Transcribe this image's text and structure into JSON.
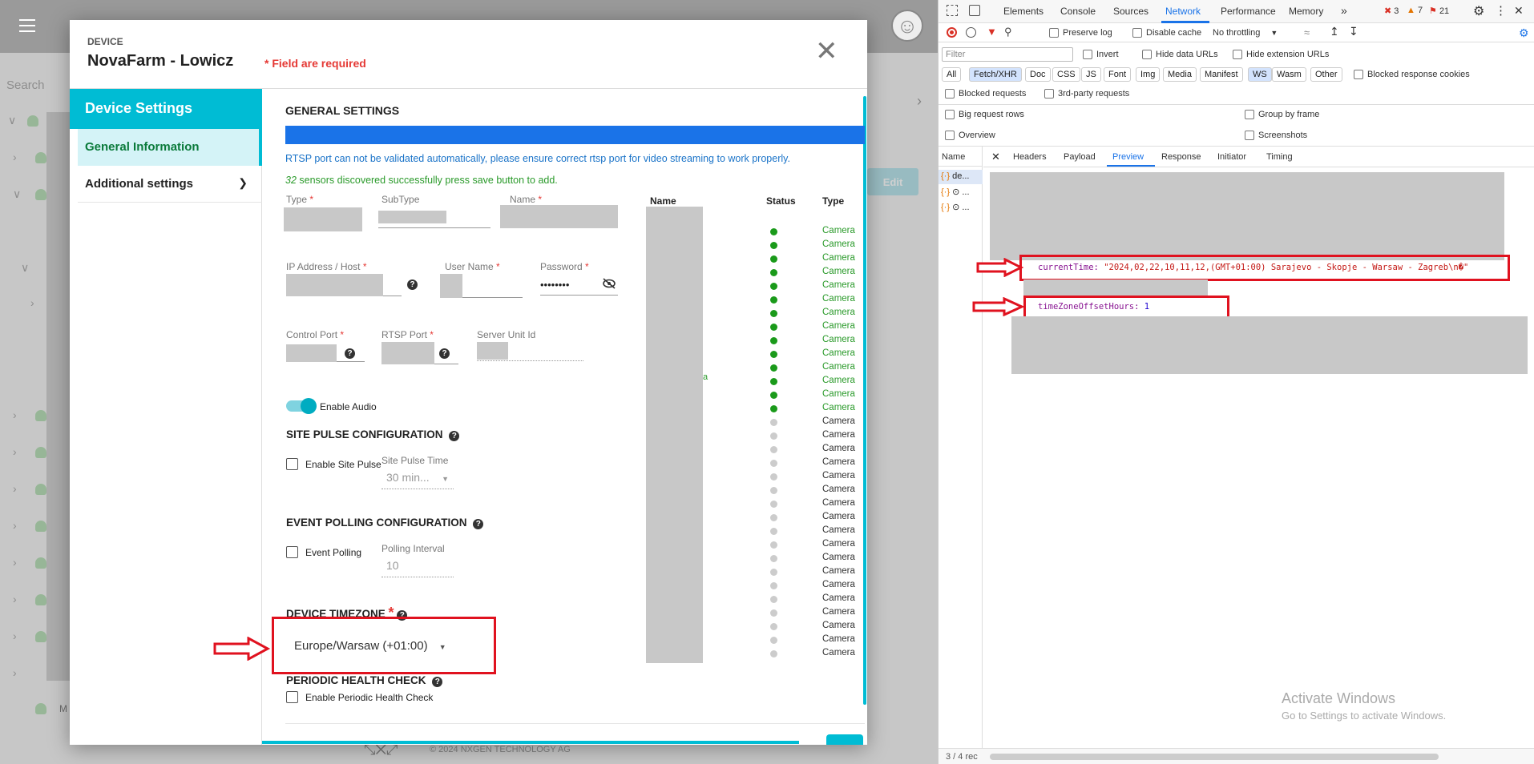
{
  "background_app": {
    "search_placeholder": "Search",
    "edit_button": "Edit",
    "footer_text": "© 2024 NXGEN TECHNOLOGY AG",
    "tree_partial_label": "M",
    "windows_watermark_title": "Activate Windows",
    "windows_watermark_sub": "Go to Settings to activate Windows."
  },
  "modal": {
    "kicker": "DEVICE",
    "title": "NovaFarm - Lowicz",
    "required_note": "* Field are required",
    "sidebar": {
      "header": "Device Settings",
      "items": [
        {
          "label": "General Information"
        },
        {
          "label": "Additional settings"
        }
      ]
    },
    "general": {
      "heading": "GENERAL SETTINGS",
      "rtsp_warning": "RTSP port can not be validated automatically, please ensure correct rtsp port for video streaming to work properly.",
      "sensors_count": "32",
      "sensors_msg": "sensors discovered successfully press save button to add.",
      "fields": {
        "type": "Type",
        "subtype": "SubType",
        "name": "Name",
        "ip": "IP Address / Host",
        "username": "User Name",
        "password": "Password",
        "password_value": "••••••••",
        "control_port": "Control Port",
        "rtsp_port": "RTSP Port",
        "server_unit_id": "Server Unit Id"
      },
      "enable_audio": "Enable Audio",
      "site_pulse_heading": "SITE PULSE CONFIGURATION",
      "enable_site_pulse": "Enable Site Pulse",
      "site_pulse_time_label": "Site Pulse Time",
      "site_pulse_time_value": "30 min...",
      "event_polling_heading": "EVENT POLLING CONFIGURATION",
      "event_polling": "Event Polling",
      "polling_interval_label": "Polling Interval",
      "polling_interval_value": "10",
      "timezone_heading": "DEVICE TIMEZONE",
      "timezone_value": "Europe/Warsaw (+01:00)",
      "health_heading": "PERIODIC HEALTH CHECK",
      "enable_health": "Enable Periodic Health Check"
    },
    "sensor_table": {
      "col_name": "Name",
      "col_status": "Status",
      "col_type": "Type",
      "stray_text": "a",
      "rows": [
        {
          "status": "online",
          "type": "Camera"
        },
        {
          "status": "online",
          "type": "Camera"
        },
        {
          "status": "online",
          "type": "Camera"
        },
        {
          "status": "online",
          "type": "Camera"
        },
        {
          "status": "online",
          "type": "Camera"
        },
        {
          "status": "online",
          "type": "Camera"
        },
        {
          "status": "online",
          "type": "Camera"
        },
        {
          "status": "online",
          "type": "Camera"
        },
        {
          "status": "online",
          "type": "Camera"
        },
        {
          "status": "online",
          "type": "Camera"
        },
        {
          "status": "online",
          "type": "Camera"
        },
        {
          "status": "online",
          "type": "Camera"
        },
        {
          "status": "online",
          "type": "Camera"
        },
        {
          "status": "online",
          "type": "Camera"
        },
        {
          "status": "offline",
          "type": "Camera"
        },
        {
          "status": "offline",
          "type": "Camera"
        },
        {
          "status": "offline",
          "type": "Camera"
        },
        {
          "status": "offline",
          "type": "Camera"
        },
        {
          "status": "offline",
          "type": "Camera"
        },
        {
          "status": "offline",
          "type": "Camera"
        },
        {
          "status": "offline",
          "type": "Camera"
        },
        {
          "status": "offline",
          "type": "Camera"
        },
        {
          "status": "offline",
          "type": "Camera"
        },
        {
          "status": "offline",
          "type": "Camera"
        },
        {
          "status": "offline",
          "type": "Camera"
        },
        {
          "status": "offline",
          "type": "Camera"
        },
        {
          "status": "offline",
          "type": "Camera"
        },
        {
          "status": "offline",
          "type": "Camera"
        },
        {
          "status": "offline",
          "type": "Camera"
        },
        {
          "status": "offline",
          "type": "Camera"
        },
        {
          "status": "offline",
          "type": "Camera"
        },
        {
          "status": "offline",
          "type": "Camera"
        }
      ]
    }
  },
  "devtools": {
    "tabs": [
      "Elements",
      "Console",
      "Sources",
      "Network",
      "Performance",
      "Memory"
    ],
    "active_tab": "Network",
    "error_count": "3",
    "warning_count": "7",
    "issue_count": "21",
    "preserve_log": "Preserve log",
    "disable_cache": "Disable cache",
    "throttling": "No throttling",
    "filter_placeholder": "Filter",
    "invert": "Invert",
    "hide_data_urls": "Hide data URLs",
    "hide_ext_urls": "Hide extension URLs",
    "type_chips": [
      "All",
      "Fetch/XHR",
      "Doc",
      "CSS",
      "JS",
      "Font",
      "Img",
      "Media",
      "Manifest",
      "WS",
      "Wasm",
      "Other"
    ],
    "blocked_cookies": "Blocked response cookies",
    "blocked_requests": "Blocked requests",
    "third_party": "3rd-party requests",
    "big_rows": "Big request rows",
    "group_by_frame": "Group by frame",
    "overview": "Overview",
    "screenshots": "Screenshots",
    "name_col": "Name",
    "request_rows": [
      "de...",
      "⊙ ...",
      "⊙ ..."
    ],
    "detail_tabs": [
      "Headers",
      "Payload",
      "Preview",
      "Response",
      "Initiator",
      "Timing"
    ],
    "active_detail_tab": "Preview",
    "current_time_key": "currentTime",
    "current_time_value": "\"2024,02,22,10,11,12,(GMT+01:00) Sarajevo - Skopje - Warsaw - Zagreb\\n�\"",
    "tz_offset_key": "timeZoneOffsetHours",
    "tz_offset_value": "1",
    "status_bar": "3 / 4 rec"
  },
  "colors": {
    "accent_teal": "#00bcd4",
    "progress_blue": "#1a73e8",
    "annotation_red": "#e0121f",
    "online_green": "#1a9a1a"
  }
}
